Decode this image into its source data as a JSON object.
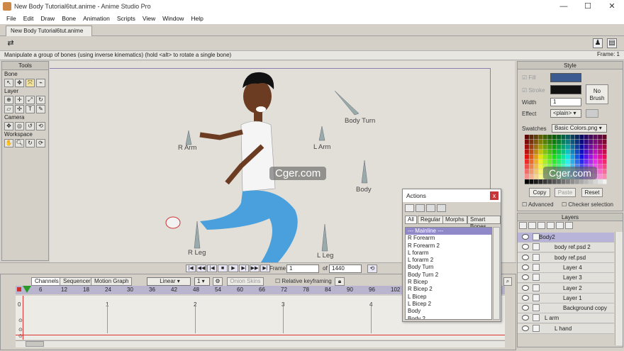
{
  "window": {
    "title": "New Body Tutorial6tut.anime - Anime Studio Pro",
    "min": "—",
    "max": "☐",
    "close": "✕"
  },
  "menu": [
    "File",
    "Edit",
    "Draw",
    "Bone",
    "Animation",
    "Scripts",
    "View",
    "Window",
    "Help"
  ],
  "doc_tab": "New Body Tutorial6tut.anime",
  "status": {
    "message": "Manipulate a group of bones (using inverse kinematics) (hold <alt> to rotate a single bone)",
    "frame": "Frame: 1"
  },
  "tools": {
    "title": "Tools",
    "sections": {
      "bone": "Bone",
      "layer": "Layer",
      "camera": "Camera",
      "workspace": "Workspace"
    }
  },
  "bones": {
    "body_turn": "Body Turn",
    "r_arm": "R Arm",
    "l_arm": "L Arm",
    "body": "Body",
    "r_leg": "R Leg",
    "l_leg": "L Leg"
  },
  "watermark": "Cger.com",
  "style": {
    "title": "Style",
    "fill": "Fill",
    "stroke": "Stroke",
    "fill_color": "#3a5a90",
    "stroke_color": "#111111",
    "no_brush": "No Brush",
    "width_label": "Width",
    "width_value": "1",
    "effect_label": "Effect",
    "effect_value": "<plain>",
    "swatches_label": "Swatches",
    "swatches_value": "Basic Colors.png",
    "copy": "Copy",
    "paste": "Paste",
    "reset": "Reset",
    "advanced": "Advanced",
    "checker": "Checker selection"
  },
  "layers": {
    "title": "Layers",
    "items": [
      "Body2",
      "body ref.psd 2",
      "body ref.psd",
      "Layer 4",
      "Layer 3",
      "Layer 2",
      "Layer 1",
      "Background copy",
      "L arm",
      "L hand"
    ]
  },
  "playback": {
    "frame_label": "Frame",
    "frame_value": "1",
    "of_label": "of",
    "total_frames": "1440"
  },
  "timeline": {
    "tabs": [
      "Channels",
      "Sequencer",
      "Motion Graph"
    ],
    "interp": "Linear",
    "interp_num": "1",
    "onion": "Onion Skins",
    "relative": "Relative keyframing",
    "ruler": [
      "0",
      "6",
      "12",
      "18",
      "24",
      "30",
      "36",
      "42",
      "48",
      "54",
      "60",
      "66",
      "72",
      "78",
      "84",
      "90",
      "96",
      "102"
    ],
    "marks": [
      "0",
      "1",
      "2",
      "3",
      "4"
    ]
  },
  "actions": {
    "title": "Actions",
    "close": "x",
    "tabs": [
      "All",
      "Regular",
      "Morphs",
      "Smart Bones"
    ],
    "items": [
      "--- Mainline ---",
      "R Forearm",
      "R Forearm 2",
      "L forarm",
      "L forarm 2",
      "Body Turn",
      "Body Turn 2",
      "R Bicep",
      "R Bicep 2",
      "L Bicep",
      "L Bicep 2",
      "Body",
      "Body 2"
    ]
  }
}
